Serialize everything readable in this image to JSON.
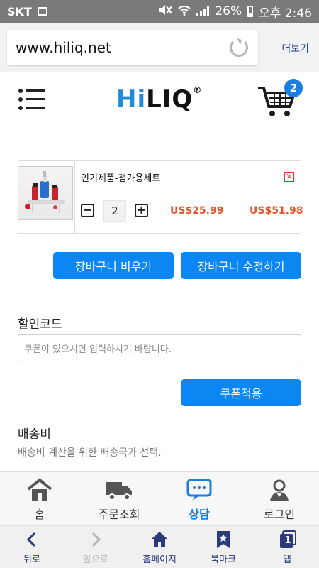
{
  "status_bar": {
    "carrier": "SKT",
    "battery": "26%",
    "time": "오후 2:46"
  },
  "browser": {
    "url": "www.hiliq.net",
    "more_label": "더보기"
  },
  "header": {
    "logo_hi": "Hi",
    "logo_liq": "LIQ",
    "logo_mark": "®",
    "cart_count": "2"
  },
  "cart": {
    "item_name": "인기제품-첨가용세트",
    "quantity": "2",
    "unit_price": "US$25.99",
    "total_price": "US$51.98",
    "remove_icon": "close-icon"
  },
  "actions": {
    "empty_cart": "장바구니 비우기",
    "update_cart": "장바구니 수정하기"
  },
  "discount": {
    "title": "할인코드",
    "placeholder": "쿠폰이 있으시면 입력하시기 바랍니다.",
    "apply": "쿠폰적용"
  },
  "shipping": {
    "title": "배송비",
    "subtitle": "배송비 계산을 위한 배송국가 선택."
  },
  "site_nav": [
    {
      "label": "홈",
      "icon": "home-icon"
    },
    {
      "label": "주문조회",
      "icon": "truck-icon"
    },
    {
      "label": "상담",
      "icon": "chat-icon",
      "active": true
    },
    {
      "label": "로그인",
      "icon": "user-icon"
    }
  ],
  "browser_nav": [
    {
      "label": "뒤로",
      "icon": "back-icon"
    },
    {
      "label": "앞으로",
      "icon": "forward-icon",
      "disabled": true
    },
    {
      "label": "홈페이지",
      "icon": "home-icon"
    },
    {
      "label": "북마크",
      "icon": "bookmark-icon"
    },
    {
      "label": "탭",
      "icon": "tabs-icon",
      "count": "1"
    }
  ],
  "colors": {
    "accent": "#0c86f2",
    "price": "#e7572b",
    "logo_blue": "#1f8bd9"
  }
}
